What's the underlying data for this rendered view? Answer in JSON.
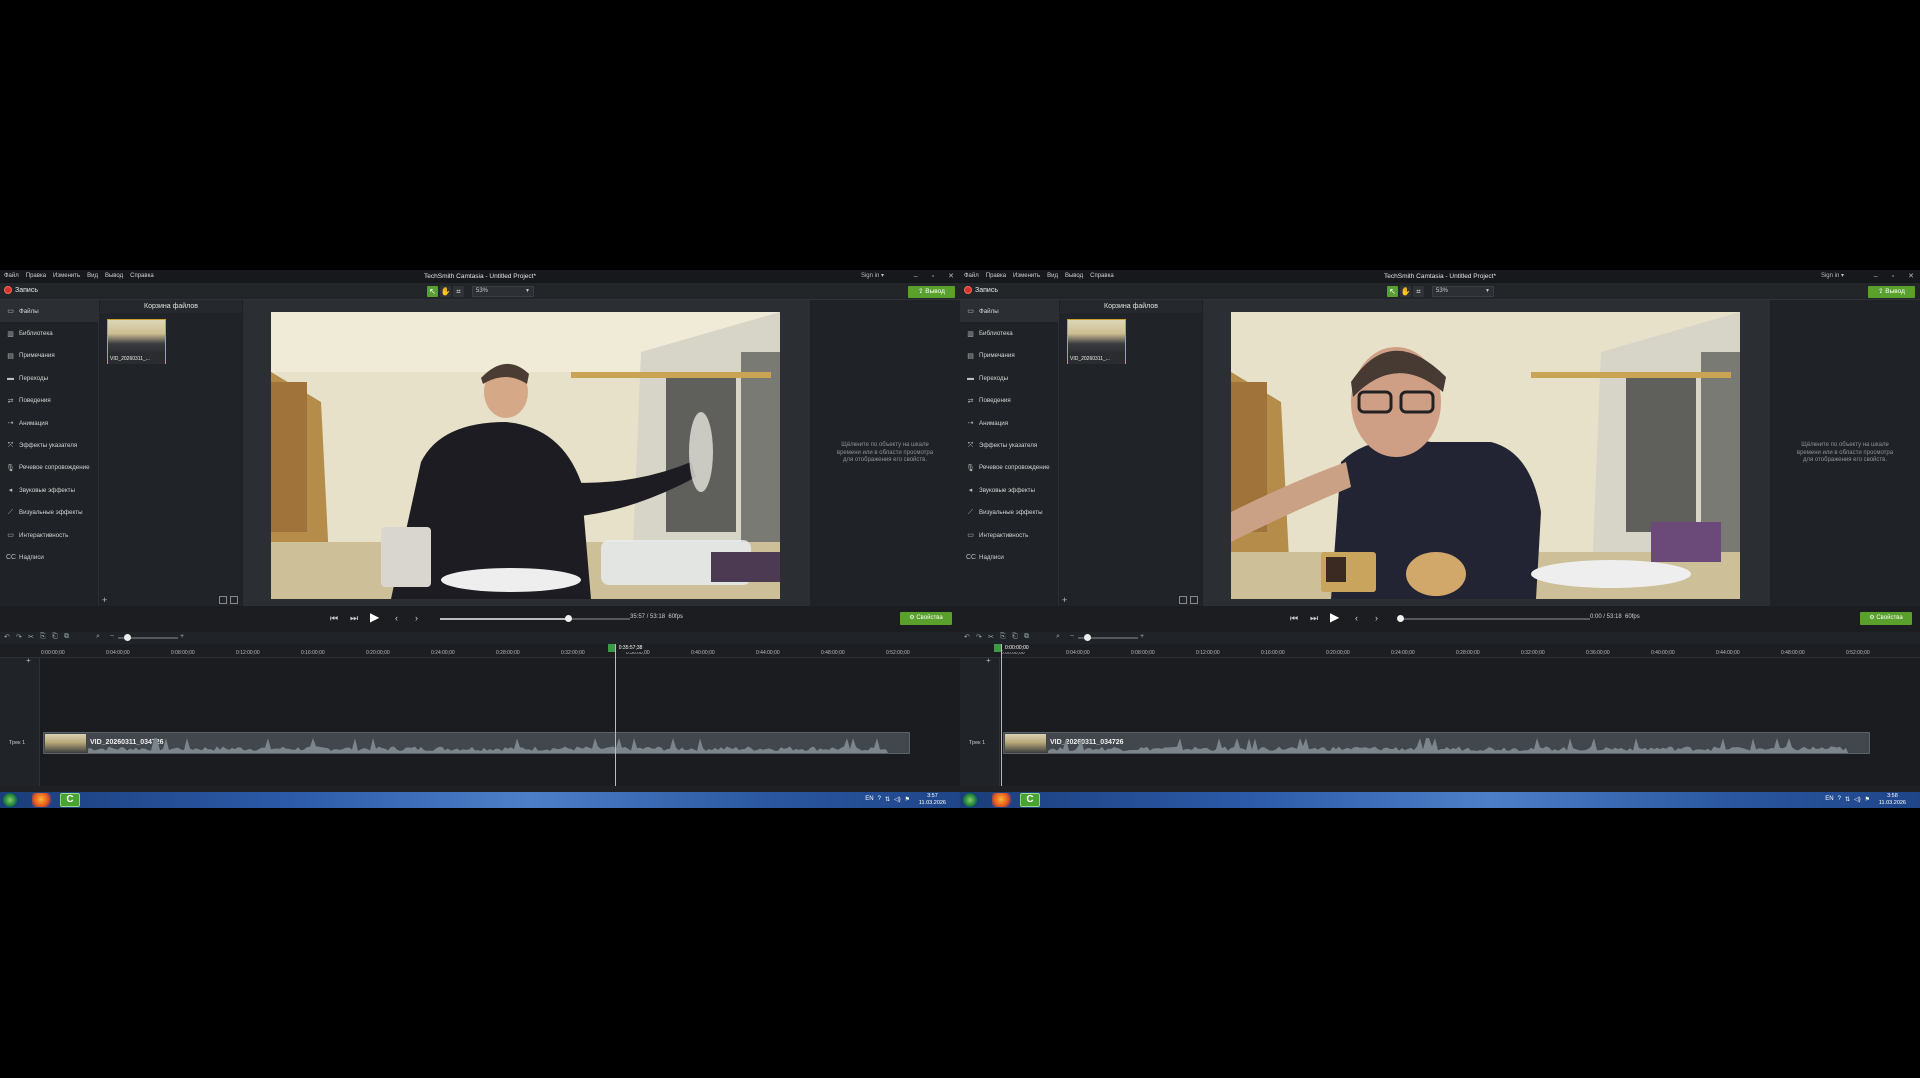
{
  "screens": [
    {
      "menu": [
        "Файл",
        "Правка",
        "Изменить",
        "Вид",
        "Вывод",
        "Справка"
      ],
      "app_title": "TechSmith Camtasia - Untitled Project*",
      "sign_in": "Sign in ▾",
      "record_label": "Запись",
      "zoom_value": "53%",
      "export_label": "Вывод",
      "sidebar": [
        "Файлы",
        "Библиотека",
        "Примечания",
        "Переходы",
        "Поведения",
        "Анимация",
        "Эффекты указателя",
        "Речевое сопровождение",
        "Звуковые эффекты",
        "Визуальные эффекты",
        "Интерактивность",
        "Надписи"
      ],
      "sidebar_icons": [
        "folder-icon",
        "library-icon",
        "annotation-icon",
        "transition-icon",
        "behavior-icon",
        "animation-icon",
        "cursor-effect-icon",
        "microphone-icon",
        "audio-effect-icon",
        "visual-effect-icon",
        "interactive-icon",
        "captions-icon"
      ],
      "bin_title": "Корзина файлов",
      "media_name": "VID_20260311_...",
      "hint_text": "Щёлкните по объекту на шкале времени или в области просмотра для отображения его свойств.",
      "time_display": "35:57 / 53:18",
      "fps": "60fps",
      "properties_label": "Свойства",
      "progress": 0.675,
      "ruler": [
        "0:00:00;00",
        "0:04:00;00",
        "0:08:00;00",
        "0:12:00;00",
        "0:16:00;00",
        "0:20:00;00",
        "0:24:00;00",
        "0:28:00;00",
        "0:32:00;00",
        "0:36:00;00",
        "0:40:00;00",
        "0:44:00;00",
        "0:48:00;00",
        "0:52:00;00"
      ],
      "playhead_label": "0:35:57;38",
      "track_name": "Трек 1",
      "clip_name": "VID_20260311_034726",
      "tray_lang": "EN",
      "clock_time": "3:57",
      "clock_date": "11.03.2026"
    },
    {
      "menu": [
        "Файл",
        "Правка",
        "Изменить",
        "Вид",
        "Вывод",
        "Справка"
      ],
      "app_title": "TechSmith Camtasia - Untitled Project*",
      "sign_in": "Sign in ▾",
      "record_label": "Запись",
      "zoom_value": "53%",
      "export_label": "Вывод",
      "sidebar": [
        "Файлы",
        "Библиотека",
        "Примечания",
        "Переходы",
        "Поведения",
        "Анимация",
        "Эффекты указателя",
        "Речевое сопровождение",
        "Звуковые эффекты",
        "Визуальные эффекты",
        "Интерактивность",
        "Надписи"
      ],
      "sidebar_icons": [
        "folder-icon",
        "library-icon",
        "annotation-icon",
        "transition-icon",
        "behavior-icon",
        "animation-icon",
        "cursor-effect-icon",
        "microphone-icon",
        "audio-effect-icon",
        "visual-effect-icon",
        "interactive-icon",
        "captions-icon"
      ],
      "bin_title": "Корзина файлов",
      "media_name": "VID_20260311_...",
      "hint_text": "Щёлкните по объекту на шкале времени или в области просмотра для отображения его свойств.",
      "time_display": "0:00 / 53:18",
      "fps": "60fps",
      "properties_label": "Свойства",
      "progress": 0.0,
      "ruler": [
        "0:00:00;00",
        "0:04:00;00",
        "0:08:00;00",
        "0:12:00;00",
        "0:16:00;00",
        "0:20:00;00",
        "0:24:00;00",
        "0:28:00;00",
        "0:32:00;00",
        "0:36:00;00",
        "0:40:00;00",
        "0:44:00;00",
        "0:48:00;00",
        "0:52:00;00"
      ],
      "playhead_label": "0:00:00;00",
      "track_name": "Трек 1",
      "clip_name": "VID_20260311_034726",
      "tray_lang": "EN",
      "clock_time": "3:58",
      "clock_date": "11.03.2026"
    }
  ],
  "colors": {
    "accent": "#5aa02c",
    "record": "#d9322a",
    "clip": "#41474d"
  }
}
